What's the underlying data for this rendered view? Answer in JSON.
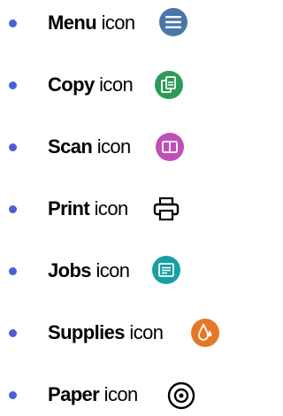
{
  "items": [
    {
      "name": "Menu",
      "suffix": "icon",
      "icon": "menu-icon",
      "color": "#4a77a8"
    },
    {
      "name": "Copy",
      "suffix": "icon",
      "icon": "copy-icon",
      "color": "#2e9a5a"
    },
    {
      "name": "Scan",
      "suffix": "icon",
      "icon": "scan-icon",
      "color": "#c04fb8"
    },
    {
      "name": "Print",
      "suffix": "icon",
      "icon": "print-icon",
      "color": "#000000"
    },
    {
      "name": "Jobs",
      "suffix": "icon",
      "icon": "jobs-icon",
      "color": "#17a0a3"
    },
    {
      "name": "Supplies",
      "suffix": "icon",
      "icon": "supplies-icon",
      "color": "#e6772a"
    },
    {
      "name": "Paper",
      "suffix": "icon",
      "icon": "paper-icon",
      "color": "#000000"
    }
  ],
  "bullet_color": "#4a5fd6"
}
